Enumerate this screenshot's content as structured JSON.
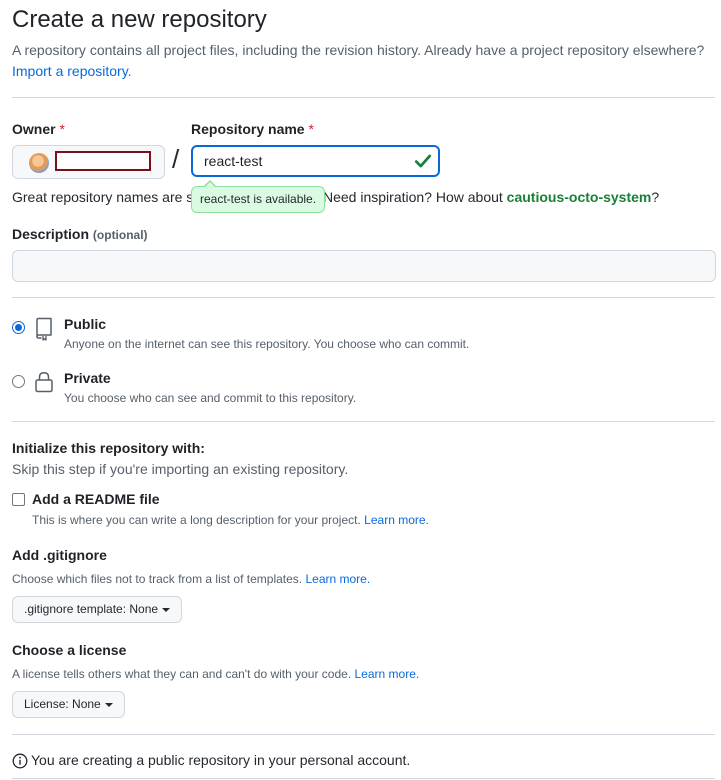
{
  "header": {
    "title": "Create a new repository",
    "subtitle": "A repository contains all project files, including the revision history. Already have a project repository elsewhere?",
    "import_link": "Import a repository."
  },
  "owner": {
    "label": "Owner",
    "required_mark": "*"
  },
  "repo_name": {
    "label": "Repository name",
    "required_mark": "*",
    "value": "react-test",
    "separator": "/"
  },
  "availability": {
    "tooltip": "react-test is available.",
    "hint_prefix": "Great repository names are sh",
    "hint_middle": "Need inspiration? How about",
    "suggestion": "cautious-octo-system",
    "hint_suffix": "?"
  },
  "description": {
    "label": "Description",
    "optional": "(optional)",
    "value": ""
  },
  "visibility": {
    "options": [
      {
        "title": "Public",
        "desc": "Anyone on the internet can see this repository. You choose who can commit.",
        "checked": true
      },
      {
        "title": "Private",
        "desc": "You choose who can see and commit to this repository.",
        "checked": false
      }
    ]
  },
  "initialize": {
    "title": "Initialize this repository with:",
    "desc": "Skip this step if you're importing an existing repository.",
    "readme_label": "Add a README file",
    "readme_desc": "This is where you can write a long description for your project.",
    "learn_more": "Learn more."
  },
  "gitignore": {
    "title": "Add .gitignore",
    "desc": "Choose which files not to track from a list of templates.",
    "learn_more": "Learn more.",
    "dropdown": ".gitignore template: None"
  },
  "license": {
    "title": "Choose a license",
    "desc": "A license tells others what they can and can't do with your code.",
    "learn_more": "Learn more.",
    "dropdown": "License: None"
  },
  "footer": {
    "info": "You are creating a public repository in your personal account."
  },
  "colors": {
    "accent": "#0969da",
    "success": "#1a7f37",
    "danger": "#cf222e"
  }
}
